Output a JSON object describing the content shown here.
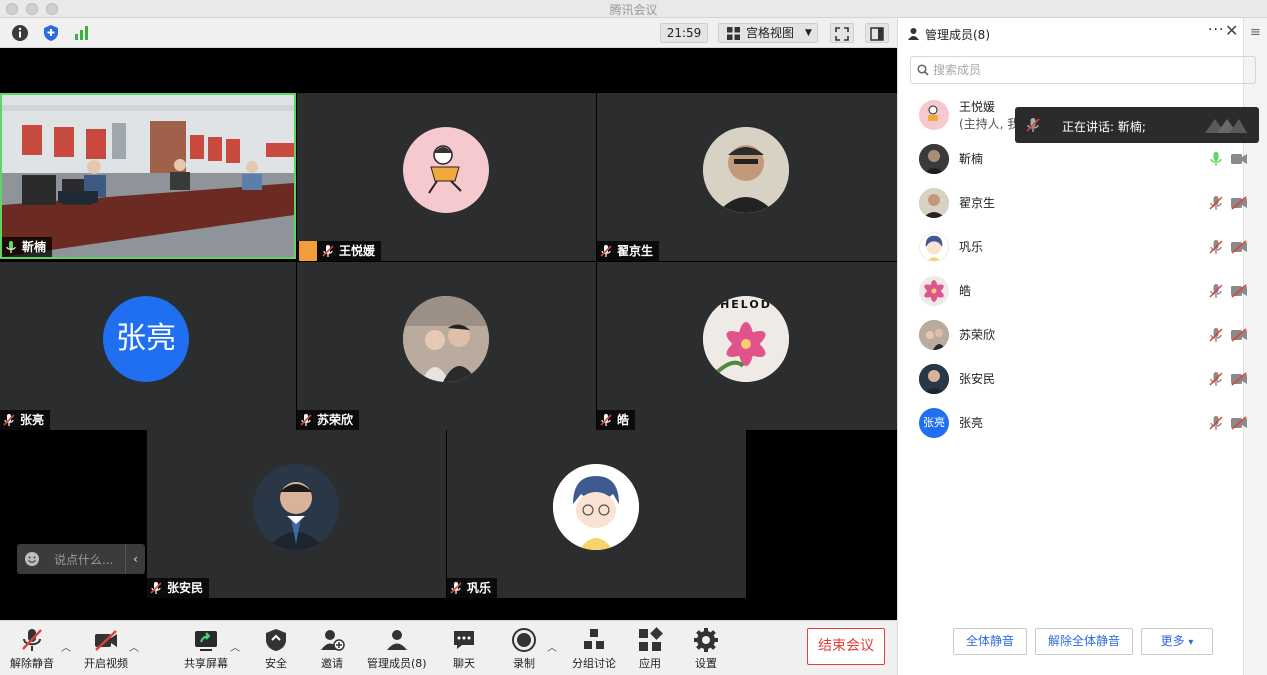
{
  "window": {
    "title": "腾讯会议"
  },
  "toolbar": {
    "time": "21:59",
    "view_label": "宫格视图"
  },
  "tiles": [
    {
      "name": "靳楠"
    },
    {
      "name": "王悦媛"
    },
    {
      "name": "翟京生"
    },
    {
      "name": "张亮",
      "initials": "张亮"
    },
    {
      "name": "苏荣欣"
    },
    {
      "name": "皓",
      "avatar_text": "HELOD"
    },
    {
      "name": "张安民"
    },
    {
      "name": "巩乐"
    }
  ],
  "chat": {
    "placeholder": "说点什么..."
  },
  "bottombar": {
    "unmute": "解除静音",
    "video": "开启视频",
    "share": "共享屏幕",
    "security": "安全",
    "invite": "邀请",
    "members": "管理成员(8)",
    "chat": "聊天",
    "record": "录制",
    "breakout": "分组讨论",
    "apps": "应用",
    "settings": "设置",
    "end": "结束会议"
  },
  "panel": {
    "title": "管理成员(8)",
    "search_placeholder": "搜索成员",
    "members": [
      {
        "name": "王悦媛",
        "sub": "(主持人, 我)"
      },
      {
        "name": "靳楠"
      },
      {
        "name": "翟京生"
      },
      {
        "name": "巩乐"
      },
      {
        "name": "皓"
      },
      {
        "name": "苏荣欣"
      },
      {
        "name": "张安民"
      },
      {
        "name": "张亮",
        "initials": "张亮"
      }
    ],
    "tooltip": "正在讲话: 靳楠;",
    "mute_all": "全体静音",
    "unmute_all": "解除全体静音",
    "more": "更多",
    "more_caret": "▾"
  },
  "colors": {
    "accent": "#2f6bdc",
    "end": "#e0403a",
    "active": "#5fd65f",
    "zhangliang": "#1f6ff0"
  }
}
